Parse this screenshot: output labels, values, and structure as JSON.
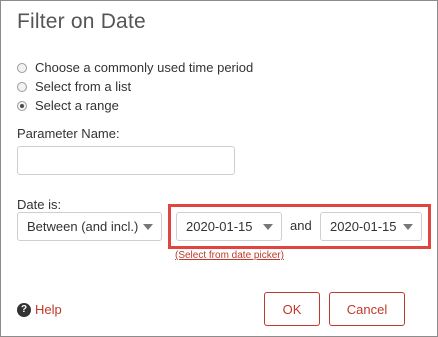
{
  "dialog": {
    "title": "Filter on Date"
  },
  "radio_options": [
    {
      "label": "Choose a commonly used time period",
      "checked": false
    },
    {
      "label": "Select from a list",
      "checked": false
    },
    {
      "label": "Select a range",
      "checked": true
    }
  ],
  "parameter": {
    "label": "Parameter Name:",
    "value": ""
  },
  "date": {
    "label": "Date is:",
    "operator": "Between (and incl.)",
    "start": "2020-01-15",
    "and_label": "and",
    "end": "2020-01-15",
    "picker_link": "(Select from date picker)"
  },
  "footer": {
    "help_label": "Help",
    "help_icon_glyph": "?",
    "ok_label": "OK",
    "cancel_label": "Cancel"
  },
  "colors": {
    "accent": "#c0392b",
    "highlight": "#e0453f"
  },
  "icons": {
    "help": "question-circle-icon",
    "dropdown": "caret-down-icon"
  }
}
